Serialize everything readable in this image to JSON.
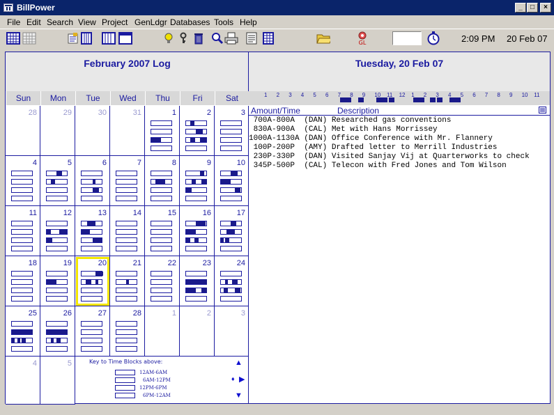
{
  "window": {
    "title": "BillPower",
    "minimize": "_",
    "maximize": "□",
    "close": "×"
  },
  "menu": [
    "File",
    "Edit",
    "Search",
    "View",
    "Project",
    "GenLdgr",
    "Databases",
    "Tools",
    "Help"
  ],
  "toolbar": {
    "gl_label": "GL",
    "clock_value": "",
    "time": "2:09 PM",
    "date": "20 Feb 07"
  },
  "calendar": {
    "title": "February 2007 Log",
    "weekdays": [
      "Sun",
      "Mon",
      "Tue",
      "Wed",
      "Thu",
      "Fri",
      "Sat"
    ],
    "days": [
      "28",
      "29",
      "30",
      "31",
      "1",
      "2",
      "3",
      "4",
      "5",
      "6",
      "7",
      "8",
      "9",
      "10",
      "11",
      "12",
      "13",
      "14",
      "15",
      "16",
      "17",
      "18",
      "19",
      "20",
      "21",
      "22",
      "23",
      "24",
      "25",
      "26",
      "27",
      "28",
      "1",
      "2",
      "3",
      "4",
      "5"
    ],
    "selected_day": "20",
    "key_title": "Key to Time Blocks above:",
    "key_labels": [
      "12AM-6AM",
      "6AM-12PM",
      "12PM-6PM",
      "6PM-12AM"
    ]
  },
  "dayview": {
    "title": "Tuesday, 20 Feb 07",
    "hour_labels": [
      "1",
      "2",
      "3",
      "4",
      "5",
      "6",
      "7",
      "8",
      "9",
      "10",
      "11",
      "12",
      "1",
      "2",
      "3",
      "4",
      "5",
      "6",
      "7",
      "8",
      "9",
      "10",
      "11"
    ],
    "col_amount": "Amount/Time",
    "col_description": "Description",
    "entries": [
      {
        "time": " 700A-800A",
        "who": "(DAN)",
        "desc": "Researched gas conventions"
      },
      {
        "time": " 830A-900A",
        "who": "(CAL)",
        "desc": "Met with Hans Morrissey"
      },
      {
        "time": "1000A-1130A",
        "who": "(DAN)",
        "desc": "Office Conference with Mr. Flannery"
      },
      {
        "time": " 100P-200P",
        "who": "(AMY)",
        "desc": "Drafted letter to Merrill Industries"
      },
      {
        "time": " 230P-330P",
        "who": "(DAN)",
        "desc": "Visited Sanjay Vij at Quarterworks to check"
      },
      {
        "time": " 345P-500P",
        "who": "(CAL)",
        "desc": "Telecon with Fred Jones and Tom Wilson"
      }
    ]
  },
  "colors": {
    "accent": "#1a1aa0",
    "block": "#1a1a8a",
    "selection": "#f3e600",
    "title_bar": "#0a246a"
  }
}
